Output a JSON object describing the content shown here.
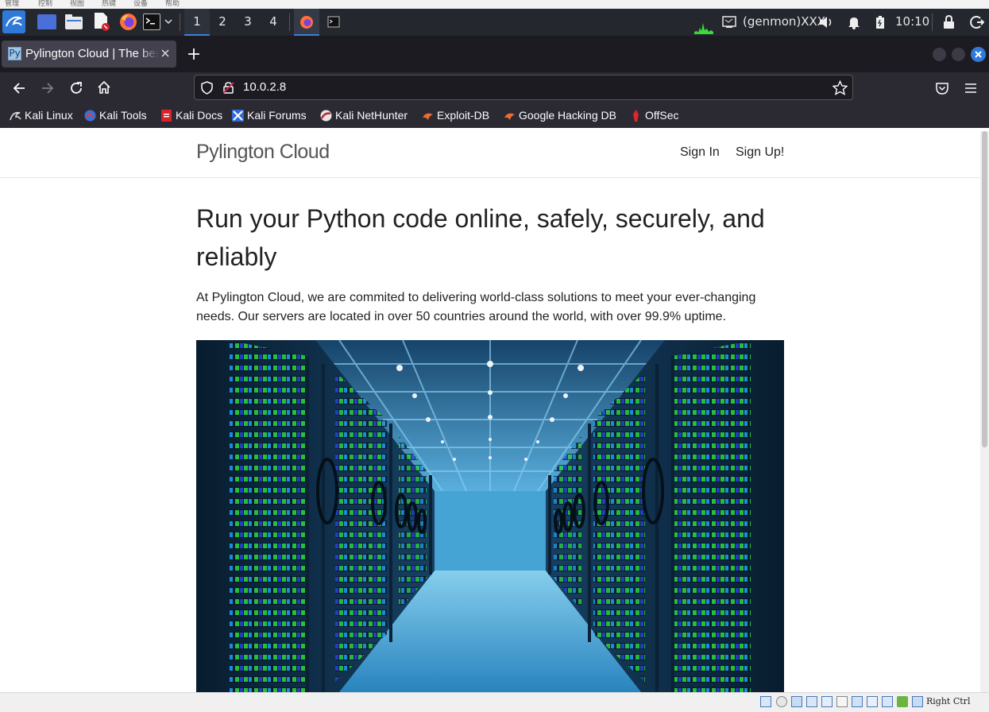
{
  "vm_menu": [
    "管理",
    "控制",
    "视图",
    "热键",
    "设备",
    "帮助"
  ],
  "taskbar": {
    "workspaces": [
      "1",
      "2",
      "3",
      "4"
    ],
    "active_workspace": 0,
    "genmon": "(genmon)XXX",
    "clock": "10:10"
  },
  "browser": {
    "tab_title": "Pylington Cloud | The best",
    "url": "10.0.2.8",
    "bookmarks": [
      {
        "label": "Kali Linux",
        "icon": "kali-dragon-icon"
      },
      {
        "label": "Kali Tools",
        "icon": "kali-tools-icon"
      },
      {
        "label": "Kali Docs",
        "icon": "kali-docs-icon"
      },
      {
        "label": "Kali Forums",
        "icon": "kali-forums-icon"
      },
      {
        "label": "Kali NetHunter",
        "icon": "nethunter-icon"
      },
      {
        "label": "Exploit-DB",
        "icon": "exploit-db-icon"
      },
      {
        "label": "Google Hacking DB",
        "icon": "ghdb-icon"
      },
      {
        "label": "OffSec",
        "icon": "offsec-icon"
      }
    ]
  },
  "site": {
    "brand": "Pylington Cloud",
    "nav": {
      "sign_in": "Sign In",
      "sign_up": "Sign Up!"
    },
    "hero_title": "Run your Python code online, safely, securely, and reliably",
    "hero_text": "At Pylington Cloud, we are commited to delivering world-class solutions to meet your ever-changing needs. Our servers are located in over 50 countries around the world, with over 99.9% uptime."
  },
  "vm_status": {
    "host_key": "Right Ctrl"
  }
}
